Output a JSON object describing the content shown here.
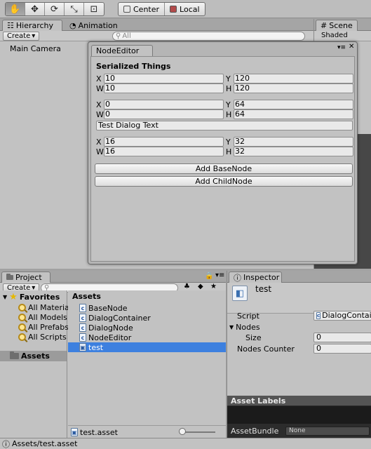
{
  "toolbar": {
    "tools": [
      {
        "name": "hand-tool",
        "glyph": "✋",
        "active": true
      },
      {
        "name": "move-tool",
        "glyph": "✥"
      },
      {
        "name": "rotate-tool",
        "glyph": "⟳"
      },
      {
        "name": "scale-tool",
        "glyph": "⤡"
      },
      {
        "name": "rect-tool",
        "glyph": "⊡"
      }
    ],
    "pivot_label": "Center",
    "space_label": "Local"
  },
  "hierarchy": {
    "tab_label": "Hierarchy",
    "animation_tab_label": "Animation",
    "create_label": "Create",
    "search_placeholder": "All",
    "items": [
      "Main Camera"
    ]
  },
  "scene": {
    "tab_label": "Scene",
    "shading_mode": "Shaded"
  },
  "node_editor": {
    "title": "NodeEditor",
    "section_title": "Serialized Things",
    "groups": [
      {
        "x": "10",
        "y": "120",
        "w": "10",
        "h": "120"
      },
      {
        "x": "0",
        "y": "64",
        "w": "0",
        "h": "64"
      },
      {
        "x": "16",
        "y": "32",
        "w": "16",
        "h": "32"
      }
    ],
    "dialog_text": "Test Dialog Text",
    "labels": {
      "x": "X",
      "y": "Y",
      "w": "W",
      "h": "H"
    },
    "add_basenode_label": "Add BaseNode",
    "add_childnode_label": "Add ChildNode"
  },
  "project": {
    "tab_label": "Project",
    "create_label": "Create",
    "favorites_label": "Favorites",
    "favorites": [
      "All Materials",
      "All Models",
      "All Prefabs",
      "All Scripts"
    ],
    "assets_folder_label": "Assets",
    "assets_header": "Assets",
    "assets": [
      "BaseNode",
      "DialogContainer",
      "DialogNode",
      "NodeEditor",
      "test"
    ],
    "selected_asset": "test",
    "footer_file": "test.asset"
  },
  "inspector": {
    "tab_label": "Inspector",
    "object_name": "test",
    "script_label": "Script",
    "script_value": "DialogContainer",
    "nodes_label": "Nodes",
    "size_label": "Size",
    "size_value": "0",
    "nodes_counter_label": "Nodes Counter",
    "nodes_counter_value": "0",
    "asset_labels_header": "Asset Labels",
    "asset_bundle_label": "AssetBundle",
    "asset_bundle_value": "None"
  },
  "status": {
    "path": "Assets/test.asset"
  },
  "colors": {
    "selection": "#3d80df",
    "panel": "#c2c2c2",
    "dark_panel": "#1b1b1b"
  }
}
